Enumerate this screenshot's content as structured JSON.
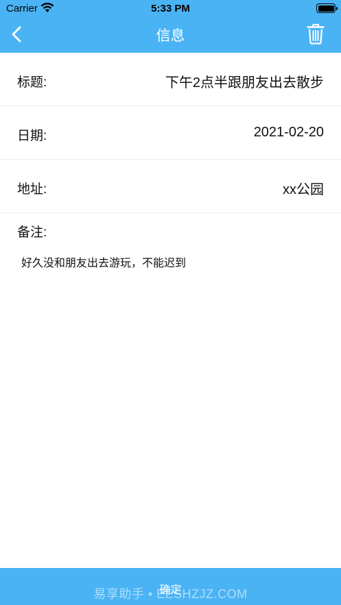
{
  "status_bar": {
    "carrier": "Carrier",
    "time": "5:33 PM",
    "wifi_icon": "wifi-icon",
    "battery_icon": "battery-icon"
  },
  "nav": {
    "title": "信息",
    "back_icon": "chevron-left-icon",
    "delete_icon": "trash-icon",
    "background_color": "#4ab3f4"
  },
  "fields": {
    "title": {
      "label": "标题:",
      "value": "下午2点半跟朋友出去散步"
    },
    "date": {
      "label": "日期:",
      "value": "2021-02-20"
    },
    "address": {
      "label": "地址:",
      "value": "xx公园"
    }
  },
  "notes": {
    "label": "备注:",
    "text": "好久没和朋友出去游玩，不能迟到"
  },
  "footer": {
    "confirm_label": "确定",
    "watermark": "易享助手 • EESHZJZ.COM"
  }
}
